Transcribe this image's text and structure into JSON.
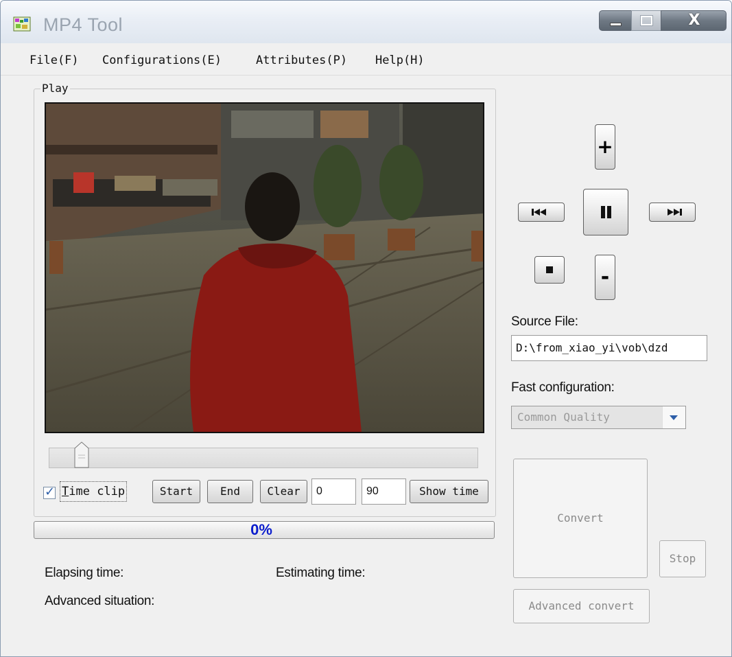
{
  "window": {
    "title": "MP4 Tool",
    "close_glyph": "X"
  },
  "menu": {
    "items": [
      "File(F)",
      "Configurations(E)",
      "Attributes(P)",
      "Help(H)"
    ]
  },
  "play": {
    "group_label": "Play",
    "seek_position_fraction": 0.06
  },
  "time_clip": {
    "checked": true,
    "label_first": "T",
    "label_rest": "ime clip",
    "start_label": "Start",
    "end_label": "End",
    "clear_label": "Clear",
    "start_value": "0",
    "end_value": "90",
    "show_time_label": "Show time"
  },
  "progress": {
    "percent": 0,
    "text": "0%"
  },
  "status": {
    "elapsing_label": "Elapsing time:",
    "estimating_label": "Estimating time:",
    "advanced_label": "Advanced situation:"
  },
  "controls": {
    "volume_up": "+",
    "volume_down": "-",
    "icons": [
      "rewind-icon",
      "pause-icon",
      "fast-forward-icon",
      "stop-icon"
    ]
  },
  "source": {
    "label": "Source File:",
    "value": "D:\\from_xiao_yi\\vob\\dzd"
  },
  "fast_config": {
    "label": "Fast configuration:",
    "selected": "Common Quality"
  },
  "actions": {
    "convert_label": "Convert",
    "stop_label": "Stop",
    "advanced_convert_label": "Advanced convert"
  },
  "colors": {
    "progress_text": "#0a1ccc",
    "window_bg": "#f0f0f0"
  }
}
